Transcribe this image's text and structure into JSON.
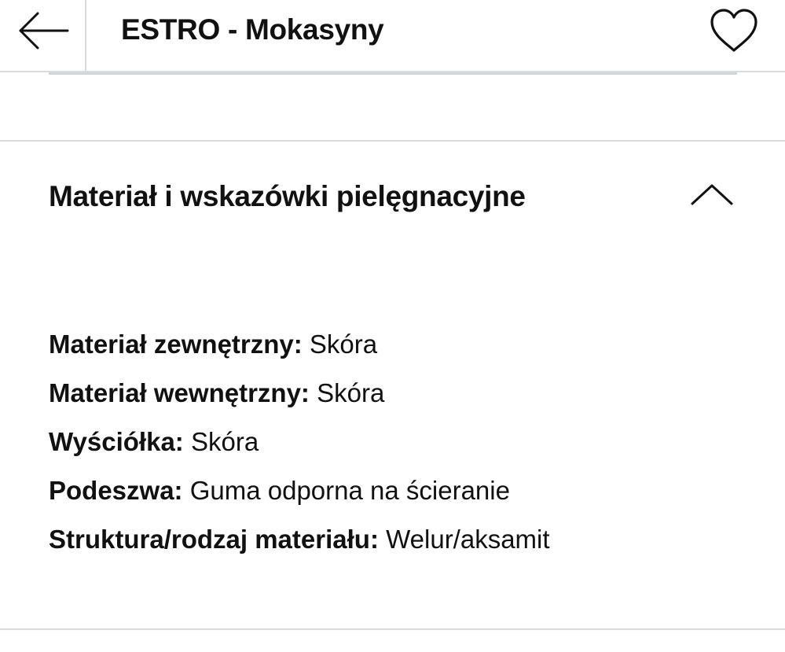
{
  "header": {
    "back_label": "back",
    "title": "ESTRO - Mokasyny",
    "favorite_label": "favorite"
  },
  "section": {
    "title": "Materiał i wskazówki pielęgnacyjne",
    "expanded": true,
    "items": [
      {
        "label": "Materiał zewnętrzny:",
        "value": "Skóra"
      },
      {
        "label": "Materiał wewnętrzny:",
        "value": "Skóra"
      },
      {
        "label": "Wyściółka:",
        "value": "Skóra"
      },
      {
        "label": "Podeszwa:",
        "value": "Guma odporna na ścieranie"
      },
      {
        "label": "Struktura/rodzaj materiału:",
        "value": "Welur/aksamit"
      }
    ]
  },
  "icons": {
    "back": "arrow-left-icon",
    "favorite": "heart-outline-icon",
    "collapse": "chevron-up-icon"
  },
  "colors": {
    "text": "#111111",
    "divider": "#d9dcdf",
    "background": "#ffffff"
  }
}
